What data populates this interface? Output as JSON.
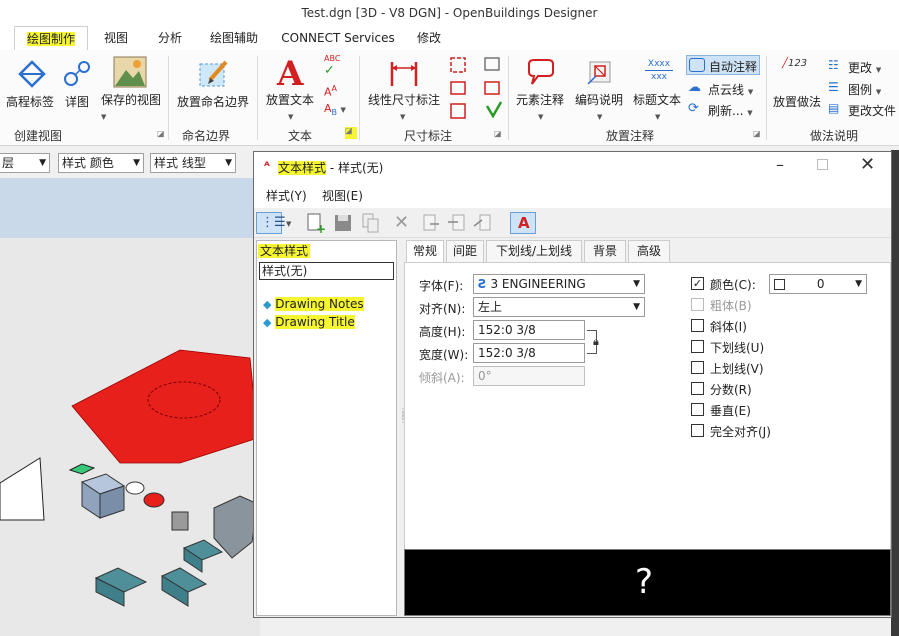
{
  "app": {
    "title": "Test.dgn [3D - V8 DGN] - OpenBuildings Designer"
  },
  "ribbon_tabs": [
    {
      "label": "绘图制作",
      "active": true
    },
    {
      "label": "视图"
    },
    {
      "label": "分析"
    },
    {
      "label": "绘图辅助"
    },
    {
      "label": "CONNECT Services"
    },
    {
      "label": "修改"
    }
  ],
  "ribbon": {
    "groups": {
      "create_view": {
        "label": "创建视图",
        "buttons": [
          "高程标签",
          "详图",
          "保存的视图"
        ]
      },
      "name_boundary": {
        "label": "命名边界",
        "buttons": [
          "放置命名边界"
        ]
      },
      "text": {
        "label": "文本",
        "buttons": [
          "放置文本"
        ],
        "abc": "ABC"
      },
      "dimension": {
        "label": "尺寸标注",
        "buttons": [
          "线性尺寸标注"
        ]
      },
      "annotation": {
        "label": "放置注释",
        "buttons": [
          "元素注释",
          "编码说明",
          "标题文本"
        ],
        "small": [
          "自动注释",
          "点云线",
          "刷新..."
        ],
        "xxx": "Xxxx"
      },
      "markup": {
        "label": "做法说明",
        "buttons": [
          "放置做法"
        ],
        "small": [
          "更改",
          "图例",
          "更改文件"
        ],
        "num": "123"
      }
    }
  },
  "attr_bar": {
    "layer": "层",
    "color": "样式 颜色",
    "linestyle": "样式 线型"
  },
  "dialog": {
    "title_highlight": "文本样式",
    "title_rest": " - 样式(无)",
    "menu": [
      "样式(Y)",
      "视图(E)"
    ],
    "tree_header": "文本样式",
    "style_none": "样式(无)",
    "styles": [
      "Drawing Notes",
      "Drawing Title"
    ],
    "tabs": [
      {
        "label": "常规",
        "active": true
      },
      {
        "label": "间距"
      },
      {
        "label": "下划线/上划线"
      },
      {
        "label": "背景"
      },
      {
        "label": "高级"
      }
    ],
    "general": {
      "font_label": "字体(F):",
      "font_value": "3   ENGINEERING",
      "justify_label": "对齐(N):",
      "justify_value": "左上",
      "height_label": "高度(H):",
      "height_value": "152:0 3/8",
      "width_label": "宽度(W):",
      "width_value": "152:0 3/8",
      "slant_label": "倾斜(A):",
      "slant_value": "0°",
      "color_label": "颜色(C):",
      "color_value": "0",
      "checkboxes": [
        {
          "label": "粗体(B)",
          "checked": false,
          "disabled": true
        },
        {
          "label": "斜体(I)",
          "checked": false
        },
        {
          "label": "下划线(U)",
          "checked": false
        },
        {
          "label": "上划线(V)",
          "checked": false
        },
        {
          "label": "分数(R)",
          "checked": false
        },
        {
          "label": "垂直(E)",
          "checked": false
        },
        {
          "label": "完全对齐(J)",
          "checked": false
        }
      ]
    },
    "preview_text": "?"
  },
  "colors": {
    "highlight": "#f5f532",
    "red_shape": "#e8201c",
    "teal_box": "#3f7f8a",
    "green_box": "#38c878"
  }
}
